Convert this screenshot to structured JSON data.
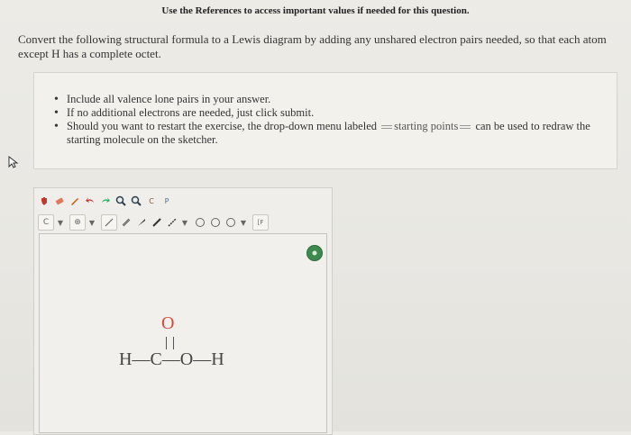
{
  "header": {
    "note": "Use the References to access important values if needed for this question."
  },
  "question": {
    "text": "Convert the following structural formula to a Lewis diagram by adding any unshared electron pairs needed, so that each atom except H has a complete octet."
  },
  "instructions": {
    "items": [
      "Include all valence lone pairs in your answer.",
      "If no additional electrons are needed, just click submit."
    ],
    "restart_prefix": "Should you want to restart the exercise, the drop-down menu labeled",
    "restart_menu_label": "starting points",
    "restart_suffix": "can be used to redraw the starting molecule on the sketcher."
  },
  "sketcher": {
    "toolbar1": [
      "hand-icon",
      "eraser-icon",
      "pencil-icon",
      "undo-icon",
      "redo-icon",
      "zoom-in-icon",
      "zoom-out-icon",
      "clean-icon",
      "periodic-table-icon"
    ],
    "toolbar1_labels": {
      "clean": "C",
      "periodic": "P"
    },
    "element_selector": "C",
    "charge_selector": "⊕",
    "template_label": "[F"
  },
  "molecule": {
    "top_atom": "O",
    "bottom_line": [
      "H",
      "C",
      "O",
      "H"
    ]
  },
  "colors": {
    "oxygen": "#d64a3a",
    "check": "#3e8a4e"
  }
}
